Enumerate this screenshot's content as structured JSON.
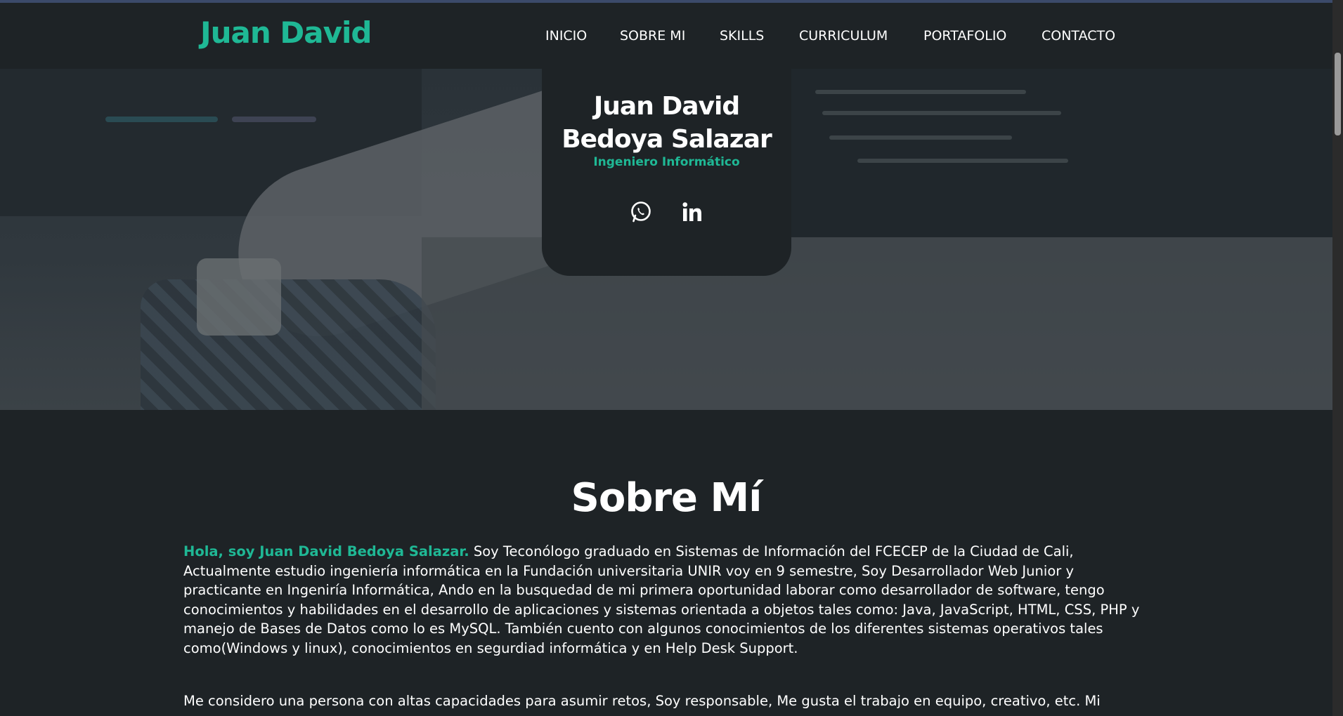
{
  "header": {
    "logo": "Juan David",
    "nav": [
      "INICIO",
      "SOBRE MI",
      "SKILLS",
      "CURRICULUM",
      "PORTAFOLIO",
      "CONTACTO"
    ]
  },
  "hero": {
    "name_line1": "Juan David",
    "name_line2": "Bedoya Salazar",
    "role": "Ingeniero Informático",
    "icons": [
      "whatsapp-icon",
      "linkedin-icon"
    ]
  },
  "about": {
    "title": "Sobre Mí",
    "highlight": "Hola, soy Juan David Bedoya Salazar.",
    "paragraph1": " Soy Teconólogo graduado en Sistemas de Información del FCECEP de la Ciudad de Cali, Actualmente estudio ingeniería informática en la Fundación universitaria UNIR voy en 9 semestre, Soy Desarrollador Web Junior y practicante en Ingeniría Informática, Ando en la busquedad de mi primera oportunidad laborar como desarrollador de software, tengo conocimientos y habilidades en el desarrollo de aplicaciones y sistemas orientada a objetos tales como: Java, JavaScript, HTML, CSS, PHP y manejo de Bases de Datos como lo es MySQL. También cuento con algunos conocimientos de los diferentes sistemas operativos tales como(Windows y linux), conocimientos en segurdiad informática y en Help Desk Support.",
    "paragraph2": "Me considero una persona con altas capacidades para asumir retos, Soy responsable, Me gusta el trabajo en equipo, creativo, etc. Mi"
  },
  "colors": {
    "accent": "#1fb895",
    "background": "#1e2326",
    "text": "#ffffff"
  }
}
